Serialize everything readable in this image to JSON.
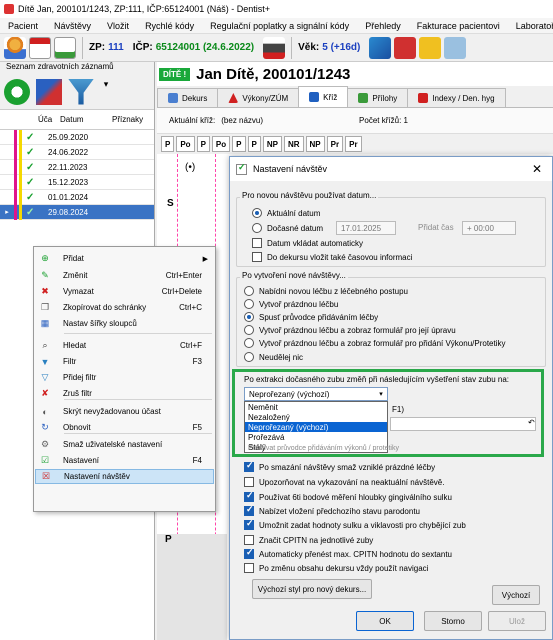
{
  "window": {
    "title": "Dítě Jan, 200101/1243, ZP:111, IČP:65124001 (Náš) - Dentist+"
  },
  "menubar": [
    "Pacient",
    "Návštěvy",
    "Vložit",
    "Rychlé kódy",
    "Regulační poplatky a signální kódy",
    "Přehledy",
    "Fakturace pacientovi",
    "Laboratoře"
  ],
  "toolbar": {
    "zp_label": "ZP:",
    "zp_value": "111",
    "icp_label": "IČP:",
    "icp_value": "65124001 (24.6.2022)",
    "age_label": "Věk:",
    "age_value": "5 (+16d)"
  },
  "left_panel": {
    "title": "Seznam zdravotních záznamů",
    "columns": {
      "uca": "Úča",
      "date": "Datum",
      "flags": "Příznaky"
    },
    "rows": [
      {
        "date": "25.09.2020",
        "selected": false
      },
      {
        "date": "24.06.2022",
        "selected": false
      },
      {
        "date": "22.11.2023",
        "selected": false
      },
      {
        "date": "15.12.2023",
        "selected": false
      },
      {
        "date": "01.01.2024",
        "selected": false
      },
      {
        "date": "29.08.2024",
        "selected": true
      }
    ]
  },
  "patient": {
    "badge": "DÍTĚ !",
    "name": "Jan Dítě, 200101/1243"
  },
  "tabs": [
    {
      "label": "Dekurs",
      "icon": "dekurs-icon",
      "color": "#4a7fd0"
    },
    {
      "label": "Výkony/ZÚM",
      "icon": "warning-icon",
      "color": "#d02020"
    },
    {
      "label": "Kříž",
      "icon": "cross-tab-icon",
      "color": "#2060c0",
      "active": true
    },
    {
      "label": "Přílohy",
      "icon": "attachment-icon",
      "color": "#3a9a3a"
    },
    {
      "label": "Indexy / Den. hyg",
      "icon": "hygiene-icon",
      "color": "#d02020"
    }
  ],
  "subtoolbar": {
    "cross_label": "Aktuální kříž:",
    "cross_value": "(bez názvu)",
    "count_label": "Počet křížů: 1"
  },
  "tooth_buttons": [
    "P",
    "Po",
    "P",
    "Po",
    "P",
    "P",
    "NP",
    "NR",
    "NP",
    "Pr",
    "Pr"
  ],
  "chart_letters": {
    "paren": "(•)",
    "s": "S",
    "p": "P"
  },
  "context_menu": {
    "items": [
      {
        "label": "Přidat",
        "shortcut": "",
        "icon": "add-icon",
        "submenu": true
      },
      {
        "label": "Změnit",
        "shortcut": "Ctrl+Enter",
        "icon": "edit-icon"
      },
      {
        "label": "Vymazat",
        "shortcut": "Ctrl+Delete",
        "icon": "delete-icon"
      },
      {
        "label": "Zkopírovat do schránky",
        "shortcut": "Ctrl+C",
        "icon": "copy-icon"
      },
      {
        "label": "Nastav šířky sloupců",
        "shortcut": "",
        "icon": "columns-icon"
      },
      {
        "label": "Hledat",
        "shortcut": "Ctrl+F",
        "icon": "search-icon"
      },
      {
        "label": "Filtr",
        "shortcut": "F3",
        "icon": "filter-icon"
      },
      {
        "label": "Přidej filtr",
        "shortcut": "",
        "icon": "add-filter-icon"
      },
      {
        "label": "Zruš filtr",
        "shortcut": "",
        "icon": "remove-filter-icon"
      },
      {
        "label": "Skrýt nevyžadovanou účast",
        "shortcut": "",
        "icon": "hide-icon"
      },
      {
        "label": "Obnovit",
        "shortcut": "F5",
        "icon": "refresh-icon"
      },
      {
        "label": "Smaž uživatelské nastavení",
        "shortcut": "",
        "icon": "reset-settings-icon"
      },
      {
        "label": "Nastavení",
        "shortcut": "F4",
        "icon": "settings-icon"
      },
      {
        "label": "Nastavení návštěv",
        "shortcut": "",
        "icon": "visit-settings-icon",
        "highlighted": true
      }
    ]
  },
  "dialog": {
    "title": "Nastavení návštěv",
    "group1": {
      "label": "Pro novou návštěvu používat datum...",
      "opt_current": "Aktuální datum",
      "opt_docasne": "Dočasné datum",
      "date_value": "17.01.2025",
      "add_time_label": "Přidat čas",
      "time_value": "+ 00:00",
      "cb_auto": "Datum vkládat automaticky",
      "cb_time": "Do dekursu vložit také časovou informaci"
    },
    "group2": {
      "label": "Po vytvoření nové návštěvy...",
      "options": [
        {
          "label": "Nabídni novou léčbu z léčebného postupu",
          "on": false
        },
        {
          "label": "Vytvoř prázdnou léčbu",
          "on": false
        },
        {
          "label": "Spusť průvodce přidáváním léčby",
          "on": true
        },
        {
          "label": "Vytvoř prázdnou léčbu a zobraz formulář pro její úpravu",
          "on": false
        },
        {
          "label": "Vytvoř prázdnou léčbu a zobraz formulář pro přidání Výkonu/Protetiky",
          "on": false
        },
        {
          "label": "Neudělej nic",
          "on": false
        }
      ]
    },
    "extraction": {
      "label": "Po extrakci dočasného zubu změň při následujícím vyšetření stav zubu na:",
      "selected": "Neprořezaný (výchozí)",
      "options": [
        "Neměnit",
        "Nezaložený",
        "Neprořezaný (výchozí)",
        "Prořezává",
        "Stálý"
      ],
      "f1_hint": "F1)",
      "hidden_text": "Používat průvodce přidáváním výkonů / protetiky"
    },
    "checkboxes": [
      {
        "label": "Po smazání návštěvy smaž vzniklé prázdné léčby",
        "on": true
      },
      {
        "label": "Upozorňovat na vykazování na neaktuální návštěvě.",
        "on": false
      },
      {
        "label": "Používat 6ti bodové měření hloubky gingiválního sulku",
        "on": true
      },
      {
        "label": "Nabízet vložení předchozího stavu parodontu",
        "on": true
      },
      {
        "label": "Umožnit zadat hodnoty sulku a viklavosti pro chybějící zub",
        "on": true
      },
      {
        "label": "Značit CPITN na jednotlivé zuby",
        "on": false
      },
      {
        "label": "Automaticky přenést max. CPITN hodnotu do sextantu",
        "on": true
      },
      {
        "label": "Po změnu obsahu dekursu vždy použít navigaci",
        "on": false
      }
    ],
    "buttons": {
      "default_style": "Výchozí styl pro nový dekurs...",
      "defaults": "Výchozí",
      "ok": "OK",
      "cancel": "Storno",
      "apply": "Ulož"
    }
  },
  "colors": {
    "accent": "#0a64d2",
    "highlight_green": "#2aa84a",
    "patient_badge": "#1aa83a",
    "selection": "#3a73c4"
  }
}
